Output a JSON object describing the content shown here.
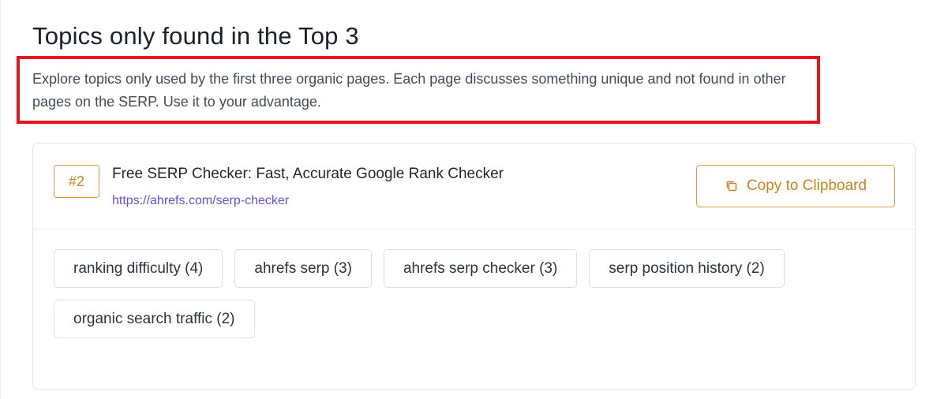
{
  "section": {
    "title": "Topics only found in the Top 3",
    "description": "Explore topics only used by the first three organic pages. Each page discusses something unique and not found in other pages on the SERP. Use it to your advantage."
  },
  "result": {
    "rank": "#2",
    "title": "Free SERP Checker: Fast, Accurate Google Rank Checker",
    "url": "https://ahrefs.com/serp-checker",
    "copy_label": "Copy to Clipboard",
    "copy_icon": "copy-icon"
  },
  "topics": [
    {
      "label": "ranking difficulty (4)"
    },
    {
      "label": "ahrefs serp (3)"
    },
    {
      "label": "ahrefs serp checker (3)"
    },
    {
      "label": "serp position history (2)"
    },
    {
      "label": "organic search traffic (2)"
    }
  ],
  "colors": {
    "accent": "#c8841e",
    "link": "#5b55e0",
    "highlight": "#e8141b"
  }
}
